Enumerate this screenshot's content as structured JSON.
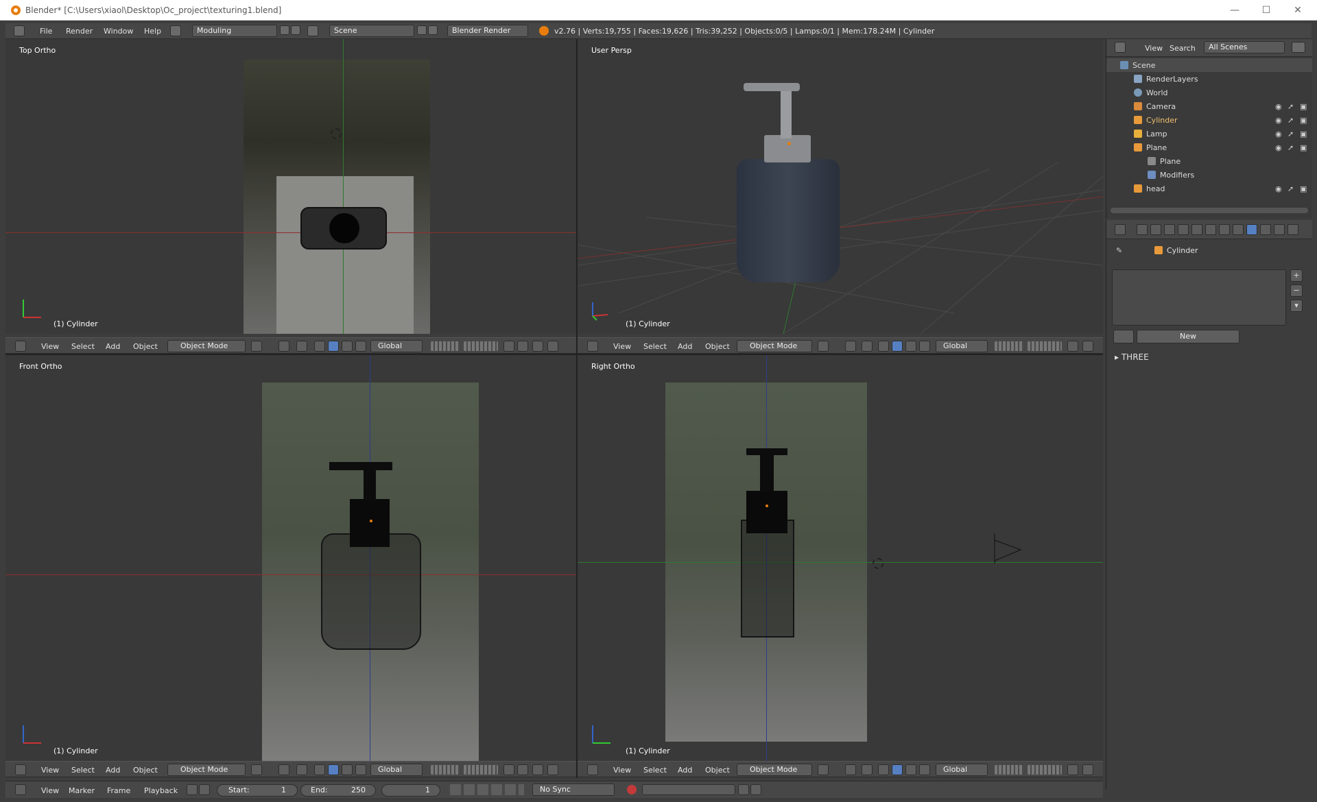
{
  "window": {
    "title": "Blender* [C:\\Users\\xiaol\\Desktop\\Oc_project\\texturing1.blend]",
    "minimize": "—",
    "maximize": "☐",
    "close": "✕"
  },
  "top_menu": {
    "items": [
      "File",
      "Render",
      "Window",
      "Help"
    ],
    "layout": "Moduling",
    "scene": "Scene",
    "engine": "Blender Render",
    "stats": "v2.76 | Verts:19,755 | Faces:19,626 | Tris:39,252 | Objects:0/5 | Lamps:0/1 | Mem:178.24M | Cylinder"
  },
  "viewports": [
    {
      "label": "Top Ortho",
      "object": "(1) Cylinder"
    },
    {
      "label": "User Persp",
      "object": "(1) Cylinder"
    },
    {
      "label": "Front Ortho",
      "object": "(1) Cylinder"
    },
    {
      "label": "Right Ortho",
      "object": "(1) Cylinder"
    }
  ],
  "view_header": {
    "menus": [
      "View",
      "Select",
      "Add",
      "Object"
    ],
    "mode": "Object Mode",
    "orientation": "Global"
  },
  "timeline": {
    "menus": [
      "View",
      "Marker",
      "Frame",
      "Playback"
    ],
    "start_label": "Start:",
    "start_value": "1",
    "end_label": "End:",
    "end_value": "250",
    "current_frame": "1",
    "sync": "No Sync"
  },
  "outliner": {
    "menus": [
      "View",
      "Search"
    ],
    "filter": "All Scenes",
    "items": [
      {
        "label": "Scene",
        "icon": "scene-icon"
      },
      {
        "label": "RenderLayers",
        "icon": "renderlayers-icon"
      },
      {
        "label": "World",
        "icon": "world-icon"
      },
      {
        "label": "Camera",
        "icon": "camera-icon"
      },
      {
        "label": "Cylinder",
        "icon": "mesh-icon"
      },
      {
        "label": "Lamp",
        "icon": "lamp-icon"
      },
      {
        "label": "Plane",
        "icon": "mesh-icon"
      },
      {
        "label": "Plane",
        "icon": "mesh-data-icon"
      },
      {
        "label": "Modifiers",
        "icon": "wrench-icon"
      },
      {
        "label": "head",
        "icon": "mesh-icon"
      }
    ]
  },
  "properties": {
    "context_object": "Cylinder",
    "new_button": "New",
    "panel": "THREE"
  },
  "colors": {
    "accent": "#5680c2",
    "orange": "#e87d0d",
    "bg": "#393939"
  }
}
